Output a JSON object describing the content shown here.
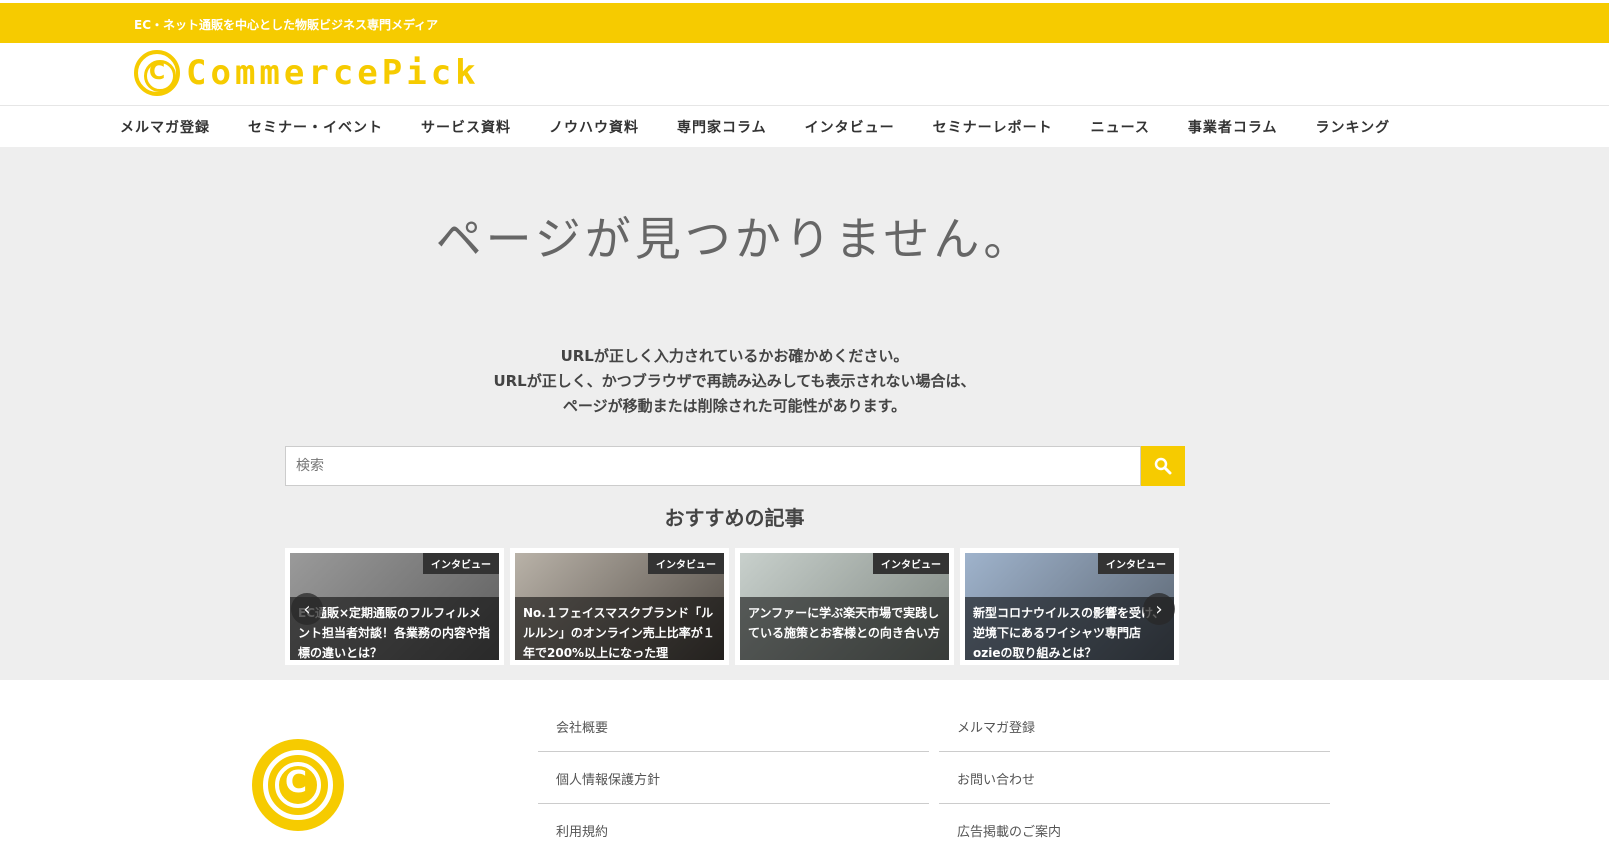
{
  "topbar": {
    "tagline": "EC・ネット通販を中心とした物販ビジネス専門メディア"
  },
  "brand": {
    "logo_text": "CommercePick",
    "logo_mark": "C",
    "accent_color": "#f6cb00"
  },
  "nav": {
    "items": [
      "メルマガ登録",
      "セミナー・イベント",
      "サービス資料",
      "ノウハウ資料",
      "専門家コラム",
      "インタビュー",
      "セミナーレポート",
      "ニュース",
      "事業者コラム",
      "ランキング"
    ]
  },
  "notfound": {
    "title": "ページが見つかりません。",
    "message_lines": [
      "URLが正しく入力されているかお確かめください。",
      "URLが正しく、かつブラウザで再読み込みしても表示されない場合は、",
      "ページが移動または削除された可能性があります。"
    ]
  },
  "search": {
    "placeholder": "検索",
    "icon": "search-icon"
  },
  "recommended": {
    "title": "おすすめの記事",
    "cards": [
      {
        "badge": "インタビュー",
        "title": "EC通販×定期通販のフルフィルメント担当者対談！各業務の内容や指標の違いとは？",
        "bg": "#7a7a7a"
      },
      {
        "badge": "インタビュー",
        "title": "No.１フェイスマスクブランド「ルルルン」のオンライン売上比率が１年で200%以上になった理",
        "bg": "#6f6a64"
      },
      {
        "badge": "インタビュー",
        "title": "アンファーに学ぶ楽天市場で実践している施策とお客様との向き合い方",
        "bg": "#8f9590"
      },
      {
        "badge": "インタビュー",
        "title": "新型コロナウイルスの影響を受け、逆境下にあるワイシャツ専門店ozieの取り組みとは？",
        "bg": "#6c7b8c"
      }
    ],
    "prev_icon": "chevron-left-icon",
    "next_icon": "chevron-right-icon"
  },
  "footer": {
    "logo_mark": "C",
    "col1": [
      "会社概要",
      "個人情報保護方針",
      "利用規約"
    ],
    "col2": [
      "メルマガ登録",
      "お問い合わせ",
      "広告掲載のご案内"
    ]
  }
}
